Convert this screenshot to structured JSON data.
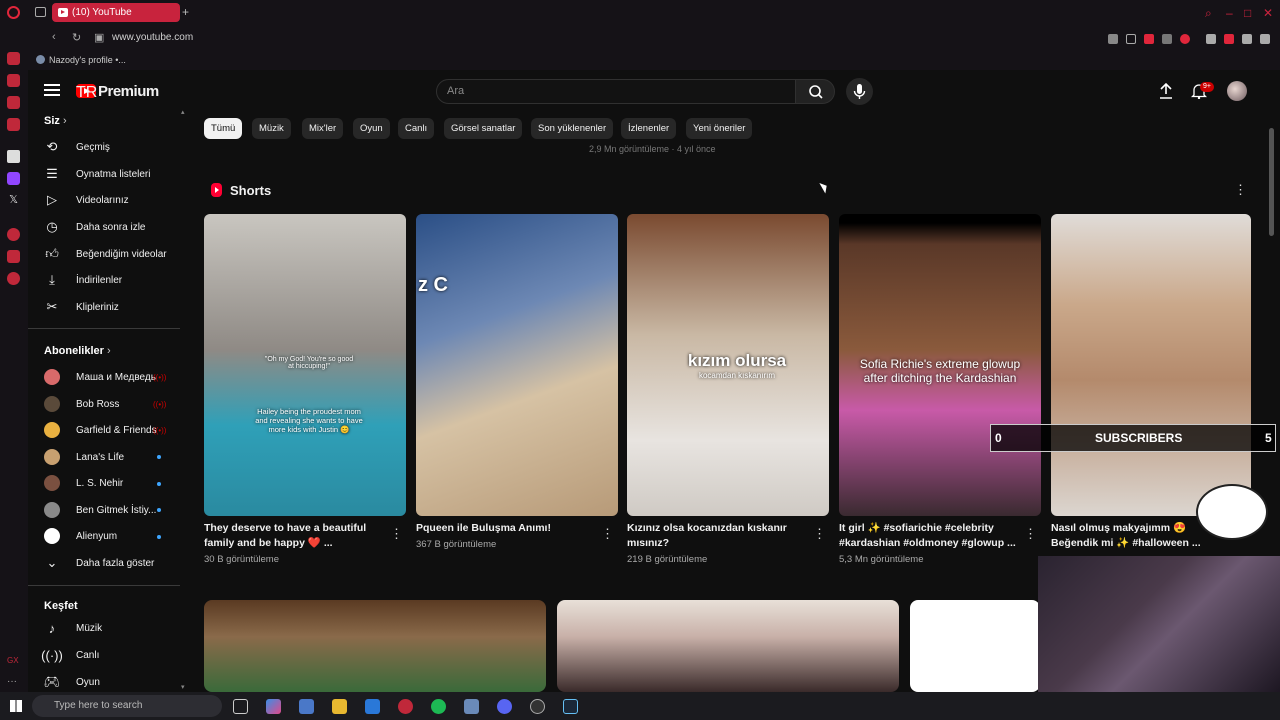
{
  "browser": {
    "tab_title": "(10) YouTube",
    "url": "www.youtube.com",
    "bookmark": "Nazody's profile •..."
  },
  "header": {
    "logo_text": "Premium",
    "region": "TR",
    "search_placeholder": "Ara",
    "notification_count": "9+"
  },
  "sidebar": {
    "you_label": "Siz",
    "you_items": [
      {
        "label": "Geçmiş",
        "icon": "history-icon"
      },
      {
        "label": "Oynatma listeleri",
        "icon": "playlists-icon"
      },
      {
        "label": "Videolarınız",
        "icon": "your-videos-icon"
      },
      {
        "label": "Daha sonra izle",
        "icon": "watch-later-icon"
      },
      {
        "label": "Beğendiğim videolar",
        "icon": "liked-videos-icon"
      },
      {
        "label": "İndirilenler",
        "icon": "downloads-icon"
      },
      {
        "label": "Klipleriniz",
        "icon": "clips-icon"
      }
    ],
    "subs_label": "Abonelikler",
    "subscriptions": [
      {
        "label": "Маша и Медведь",
        "status": "live",
        "color": "#d86a6a"
      },
      {
        "label": "Bob Ross",
        "status": "live",
        "color": "#5a4a3a"
      },
      {
        "label": "Garfield & Friends",
        "status": "live",
        "color": "#e8b040"
      },
      {
        "label": "Lana's Life",
        "status": "new",
        "color": "#c8a070"
      },
      {
        "label": "L. S. Nehir",
        "status": "new",
        "color": "#7a5040"
      },
      {
        "label": "Ben Gitmek İstiy...",
        "status": "new",
        "color": "#8a8a8a"
      },
      {
        "label": "Alienyum",
        "status": "new",
        "color": "#ffffff"
      }
    ],
    "show_more": "Daha fazla göster",
    "explore_label": "Keşfet",
    "explore_items": [
      {
        "label": "Müzik",
        "icon": "music-icon"
      },
      {
        "label": "Canlı",
        "icon": "live-icon"
      },
      {
        "label": "Oyun",
        "icon": "gaming-icon"
      }
    ]
  },
  "chips": [
    "Tümü",
    "Müzik",
    "Mix'ler",
    "Oyun",
    "Canlı",
    "Görsel sanatlar",
    "Son yüklenenler",
    "İzlenenler",
    "Yeni öneriler"
  ],
  "previous_meta": "2,9 Mn görüntüleme · 4 yıl önce",
  "shorts": {
    "title": "Shorts",
    "items": [
      {
        "title": "They deserve to have a beautiful family and be happy ❤️ ...",
        "views": "30 B görüntüleme",
        "overlay": "Hailey being the proudest mom and revealing she wants to have more kids with Justin 😊",
        "overlay_top": "\"Oh my God! You're so good at hiccuping!\""
      },
      {
        "title": "Pqueen ile Buluşma Anımı!",
        "views": "367 B görüntüleme",
        "overlay": "z C"
      },
      {
        "title": "Kızınız olsa kocanızdan kıskanır mısınız?",
        "views": "219 B görüntüleme",
        "overlay": "kızım olursa",
        "overlay_sub": "kocamdan kıskanırım"
      },
      {
        "title": "It girl ✨ #sofiarichie #celebrity #kardashian #oldmoney #glowup ...",
        "views": "5,3 Mn görüntüleme",
        "overlay": "Sofia Richie's extreme glowup after ditching the Kardashian"
      },
      {
        "title": "Nasıl olmuş makyajımm 😍 Beğendik mi ✨ #halloween ...",
        "views": "",
        "overlay": ""
      }
    ]
  },
  "stream_overlay": {
    "subs_left": "0",
    "subs_label": "SUBSCRIBERS",
    "subs_right": "5"
  },
  "taskbar": {
    "search_placeholder": "Type here to search"
  }
}
